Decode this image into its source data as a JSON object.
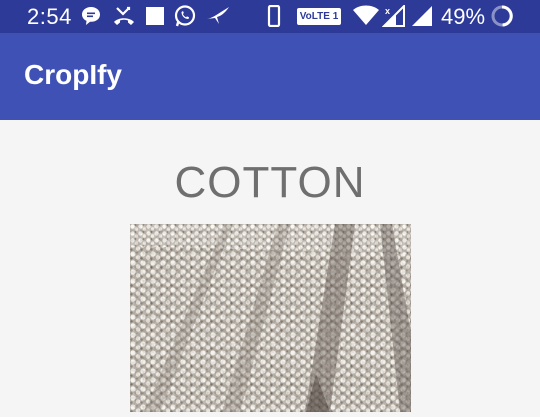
{
  "status_bar": {
    "time": "2:54",
    "volte_label": "VoLTE 1",
    "battery_percent": "49%",
    "notification_icons": [
      "message-bubble-icon",
      "missed-call-icon",
      "square-notification-icon",
      "whatsapp-icon",
      "airplane-send-icon"
    ],
    "system_icons": [
      "phone-vibrate-icon",
      "volte-badge",
      "wifi-icon",
      "signal-x-icon",
      "signal-icon",
      "battery-ring-icon"
    ]
  },
  "app_bar": {
    "title": "CropIfy",
    "color": "#3f51b5"
  },
  "main": {
    "crop_name": "COTTON",
    "image_alt": "cotton-field-image"
  },
  "colors": {
    "status_bar": "#2d3a98",
    "app_bar": "#3f51b5",
    "background": "#f5f5f5",
    "heading_text": "#6f6f6f"
  }
}
